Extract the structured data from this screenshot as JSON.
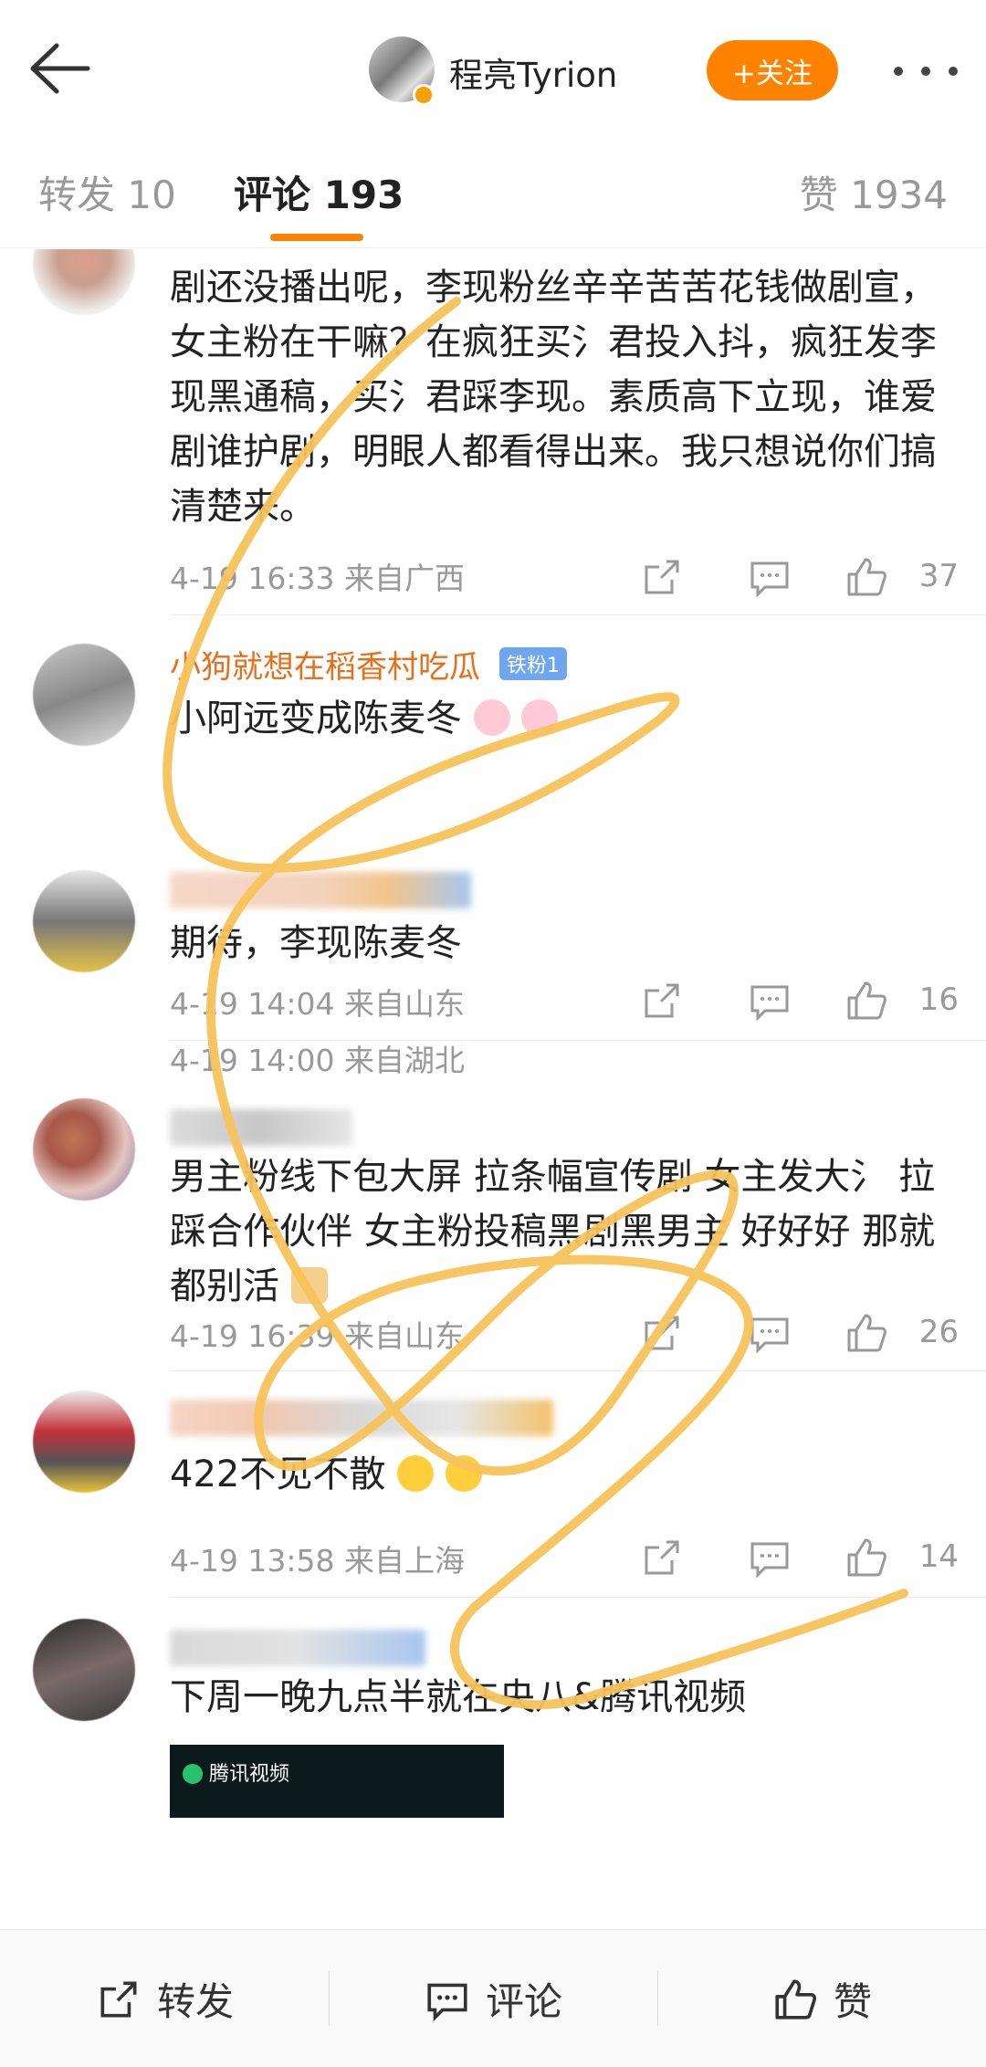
{
  "header": {
    "username": "程亮Tyrion",
    "follow_label": "+关注"
  },
  "tabs": {
    "forward": "转发 10",
    "comment": "评论 193",
    "like": "赞 1934"
  },
  "comments": [
    {
      "text": "剧还没播出呢，李现粉丝辛辛苦苦花钱做剧宣，女主粉在干嘛？在疯狂买氵君投入抖，疯狂发李现黑通稿，买氵君踩李现。素质高下立现，谁爱剧谁护剧，明眼人都看得出来。我只想说你们搞清楚来。",
      "meta": "4-19 16:33 来自广西",
      "likes": "37"
    },
    {
      "name": "小狗就想在稻香村吃瓜",
      "badge": "铁粉1",
      "text": "小阿远变成陈麦冬",
      "meta": "4-19 14:00 来自湖北",
      "likes": ""
    },
    {
      "text": "期待，李现陈麦冬",
      "meta": "4-19 14:04 来自山东",
      "likes": "16"
    },
    {
      "text": "男主粉线下包大屏 拉条幅宣传剧 女主发大氵 拉踩合作伙伴 女主粉投稿黑剧黑男主 好好好 那就都别活",
      "meta": "4-19 16:39 来自山东",
      "likes": "26"
    },
    {
      "text": "422不见不散",
      "meta": "4-19 13:58 来自上海",
      "likes": "14"
    },
    {
      "text": "下周一晚九点半就在央八&腾讯视频",
      "video_label": "腾讯视频"
    }
  ],
  "bottom": {
    "forward": "转发",
    "comment": "评论",
    "like": "赞"
  },
  "colors": {
    "accent": "#ff8200",
    "username": "#e86f1a",
    "scribble": "#f7c35a"
  }
}
